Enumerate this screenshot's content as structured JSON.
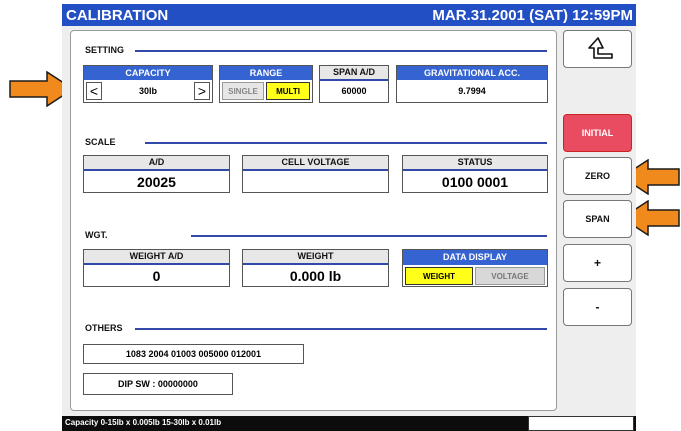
{
  "titlebar": {
    "title": "CALIBRATION",
    "datetime": "MAR.31.2001 (SAT) 12:59PM"
  },
  "setting": {
    "section_label": "SETTING",
    "capacity": {
      "header": "CAPACITY",
      "value": "30lb",
      "prev": "<",
      "next": ">"
    },
    "range": {
      "header": "RANGE",
      "single_label": "SINGLE",
      "multi_label": "MULTI",
      "selected": "MULTI"
    },
    "span_ad": {
      "header": "SPAN A/D",
      "value": "60000"
    },
    "grav_acc": {
      "header": "GRAVITATIONAL ACC.",
      "value": "9.7994"
    }
  },
  "scale": {
    "section_label": "SCALE",
    "ad": {
      "header": "A/D",
      "value": "20025"
    },
    "cell_voltage": {
      "header": "CELL VOLTAGE",
      "value": ""
    },
    "status": {
      "header": "STATUS",
      "value": "0100 0001"
    }
  },
  "wgt": {
    "section_label": "WGT.",
    "weight_ad": {
      "header": "WEIGHT A/D",
      "value": "0"
    },
    "weight": {
      "header": "WEIGHT",
      "value": "0.000 lb"
    },
    "data_display": {
      "header": "DATA DISPLAY",
      "weight_label": "WEIGHT",
      "voltage_label": "VOLTAGE",
      "selected": "WEIGHT"
    }
  },
  "others": {
    "section_label": "OTHERS",
    "code_line": "1083 2004 01003 005000 012001",
    "dip_sw": "DIP SW : 00000000"
  },
  "side_buttons": {
    "back": "back",
    "initial": "INITIAL",
    "zero": "ZERO",
    "span": "SPAN",
    "plus": "+",
    "minus": "-"
  },
  "status_bar": {
    "text": "Capacity 0-15lb x 0.005lb  15-30lb x 0.01lb"
  },
  "colors": {
    "title_bg": "#234fc4",
    "header_blue": "#3563d1",
    "multi_yellow": "#ffff1a",
    "initial_red": "#e94b60",
    "pointer_orange": "#f08a1c"
  }
}
